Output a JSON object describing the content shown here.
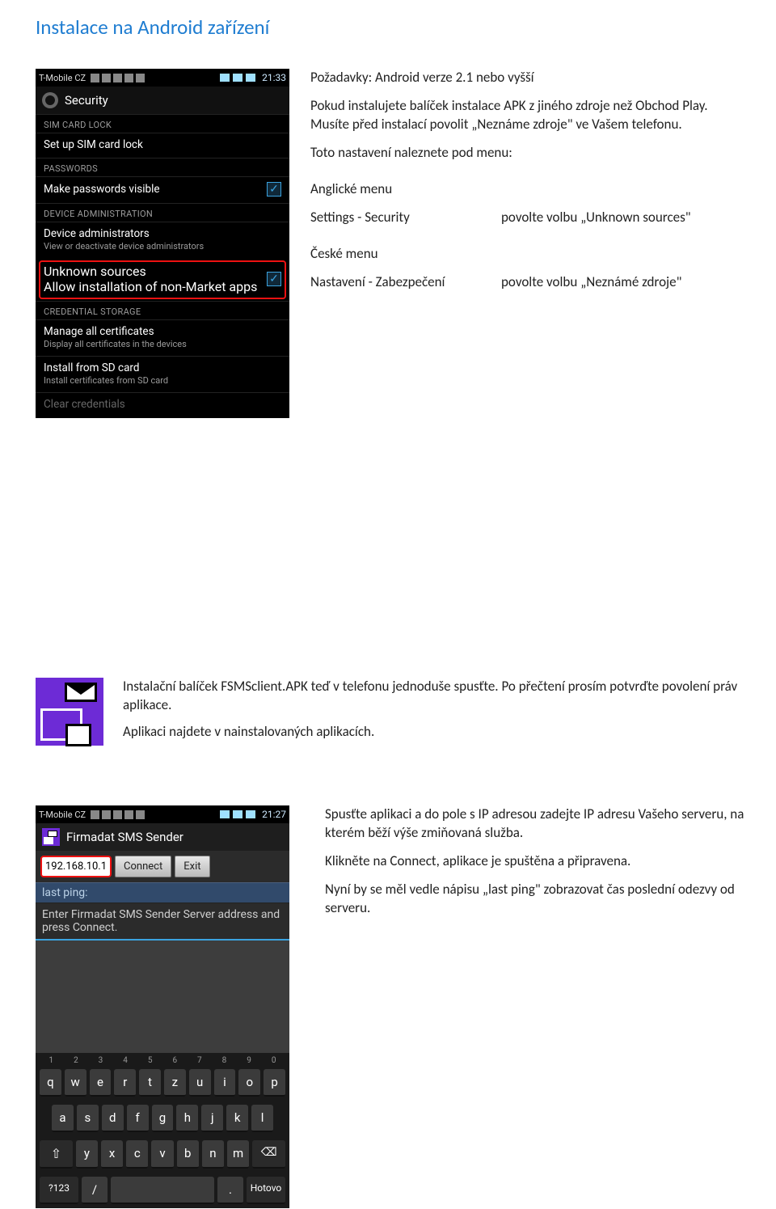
{
  "page": {
    "title": "Instalace na Android zařízení"
  },
  "intro": {
    "p1": "Požadavky: Android verze 2.1 nebo vyšší",
    "p2": "Pokud instalujete balíček instalace APK z jiného zdroje než Obchod Play. Musíte před instalací povolit „Neznáme zdroje\" ve Vašem telefonu.",
    "p3": "Toto nastavení naleznete pod menu:",
    "en_heading": "Anglické menu",
    "en_left": "Settings - Security",
    "en_right": "povolte volbu „Unknown sources\"",
    "cz_heading": "České menu",
    "cz_left": "Nastavení - Zabezpečení",
    "cz_right": "povolte volbu „Neznámé zdroje\""
  },
  "shot1": {
    "carrier": "T-Mobile CZ",
    "time": "21:33",
    "header": "Security",
    "cat_sim": "SIM CARD LOCK",
    "sim_row": "Set up SIM card lock",
    "cat_pw": "PASSWORDS",
    "pw_row": "Make passwords visible",
    "cat_admin": "DEVICE ADMINISTRATION",
    "admin_label": "Device administrators",
    "admin_sub": "View or deactivate device administrators",
    "unk_label": "Unknown sources",
    "unk_sub": "Allow installation of non-Market apps",
    "cat_cred": "CREDENTIAL STORAGE",
    "cred1_label": "Manage all certificates",
    "cred1_sub": "Display all certificates in the devices",
    "cred2_label": "Install from SD card",
    "cred2_sub": "Install certificates from SD card",
    "clear": "Clear credentials"
  },
  "section2": {
    "p1": "Instalační balíček FSMSclient.APK teď v telefonu jednoduše spusťte. Po přečtení prosím potvrďte povolení práv aplikace.",
    "p2": "Aplikaci najdete v nainstalovaných aplikacích."
  },
  "section3": {
    "p1": "Spusťte aplikaci a do pole s IP adresou zadejte IP adresu Vašeho serveru, na kterém běží výše zmiňovaná služba.",
    "p2": "Klikněte na Connect, aplikace je spuštěna a připravena.",
    "p3": "Nyní by se měl vedle nápisu „last ping\" zobrazovat čas poslední odezvy od serveru."
  },
  "shot2": {
    "carrier": "T-Mobile CZ",
    "time": "21:27",
    "header": "Firmadat SMS Sender",
    "ip": "192.168.10.1",
    "connect": "Connect",
    "exit": "Exit",
    "lastping": "last ping:",
    "placeholder": "Enter Firmadat SMS Sender Server address and press Connect.",
    "kbd": {
      "nums": [
        "1",
        "2",
        "3",
        "4",
        "5",
        "6",
        "7",
        "8",
        "9",
        "0"
      ],
      "r1": [
        "q",
        "w",
        "e",
        "r",
        "t",
        "z",
        "u",
        "i",
        "o",
        "p"
      ],
      "r2": [
        "a",
        "s",
        "d",
        "f",
        "g",
        "h",
        "j",
        "k",
        "l"
      ],
      "r3_mid": [
        "y",
        "x",
        "c",
        "v",
        "b",
        "n",
        "m"
      ],
      "sym": "?123",
      "slash": "/",
      "dot": ".",
      "done": "Hotovo"
    }
  }
}
